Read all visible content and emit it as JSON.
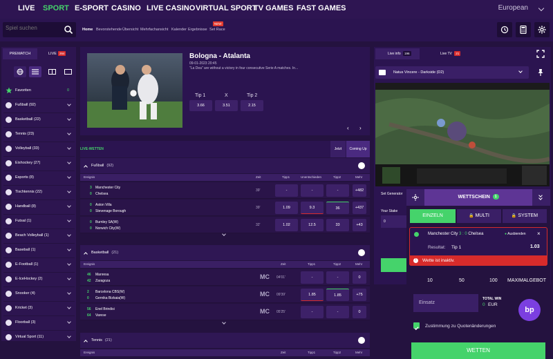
{
  "nav": {
    "items": [
      "LIVE",
      "SPORT",
      "E-SPORT",
      "CASINO",
      "LIVE CASINO",
      "VIRTUAL SPORT",
      "TV GAMES",
      "FAST GAMES"
    ],
    "language": "European"
  },
  "search": {
    "placeholder": "Spiel suchen"
  },
  "sublinks": [
    "Home",
    "Bevorstehende",
    "Übersicht",
    "Mehrfachansicht",
    "Kalender",
    "Ergebnisse",
    "Set Race"
  ],
  "new_badge": "NEW",
  "left": {
    "tab_prematch": "PREMATCH",
    "tab_live": "LIVE",
    "live_count": "264",
    "favorites_label": "Favoriten",
    "favorites_count": "0",
    "sports": [
      "Fußball (92)",
      "Basketball (22)",
      "Tennis (23)",
      "Volleyball (33)",
      "Eishockey (27)",
      "Esports (8)",
      "Tischtennis (22)",
      "Handball (8)",
      "Futsal (1)",
      "Beach Volleyball (1)",
      "Baseball (1)",
      "E-Football (1)",
      "E-IceHockey (2)",
      "Snooker (4)",
      "Kricket (3)",
      "Floorball (3)",
      "Virtual Sport (11)"
    ]
  },
  "featured": {
    "title": "Bologna - Atalanta",
    "datetime": "09-01-2023 20:45",
    "description": "\"La Dea\" are without a victory in four consecutive Serie A matches. In...",
    "odds": [
      {
        "label": "Tip 1",
        "value": "3.66"
      },
      {
        "label": "X",
        "value": "3.51"
      },
      {
        "label": "Tip 2",
        "value": "2.15"
      }
    ]
  },
  "livewetten": {
    "label": "LIVE-WETTEN",
    "jetzt": "Jetzt",
    "coming": "Coming Up"
  },
  "fussball": {
    "title": "Fußball",
    "count": "(92)",
    "headers": {
      "event": "Ereignis",
      "time": "Zeit",
      "tip1": "Tipp1",
      "draw": "Unentschieden",
      "tip2": "Tipp2",
      "more": "Mehr"
    },
    "rows": [
      {
        "s1": "3",
        "t1": "Manchester City",
        "s2": "0",
        "t2": "Chelsea",
        "time": "39'",
        "o1": "-",
        "o2": "-",
        "o3": "-",
        "more": "+482"
      },
      {
        "s1": "0",
        "t1": "Aston Villa",
        "s2": "0",
        "t2": "Stevenage Borough",
        "time": "39'",
        "o1": "1.09",
        "o2": "9.3",
        "o3": "36",
        "more": "+437"
      },
      {
        "s1": "0",
        "t1": "Burnley SA(W)",
        "s2": "0",
        "t2": "Norwich City(W)",
        "time": "32'",
        "o1": "1.02",
        "o2": "12.5",
        "o3": "33",
        "more": "+43"
      }
    ]
  },
  "basketball": {
    "title": "Basketball",
    "count": "(21)",
    "headers": {
      "event": "Ereignis",
      "time": "Zeit",
      "tip1": "Tipp1",
      "tip2": "Tipp2",
      "more": "Mehr"
    },
    "rows": [
      {
        "s1": "46",
        "t1": "Manresa",
        "s2": "42",
        "t2": "Zaragoza",
        "time": "04'01'",
        "o1": "-",
        "o3": "-",
        "more": "0"
      },
      {
        "s1": "2",
        "t1": "Barcelona CBS(W)",
        "s2": "0",
        "t2": "Gernika Bizkaia(W)",
        "time": "09'39'",
        "o1": "1.85",
        "o3": "1.85",
        "more": "+75"
      },
      {
        "s1": "56",
        "t1": "Enel Brindisi",
        "s2": "64",
        "t2": "Varese",
        "time": "05'25'",
        "o1": "-",
        "o3": "-",
        "more": "0"
      }
    ],
    "mc": "MC"
  },
  "tennis": {
    "title": "Tennis",
    "count": "(21)",
    "headers": {
      "event": "Ereignis",
      "time": "Zeit",
      "tip1": "Tipp1",
      "tip2": "Tipp2",
      "more": "Mehr"
    }
  },
  "right": {
    "tab_info": "Live info",
    "info_count": "196",
    "tab_tv": "Live TV",
    "tv_count": "21",
    "stream": "Natus Vincere - Darkside (D2)",
    "set_generator": "Set Generator",
    "your_stake": "Your Stake",
    "stake_value": "0"
  },
  "betslip": {
    "title": "WETTSCHEIN",
    "count": "1",
    "tabs": [
      "EINZELN",
      "MULTI",
      "SYSTEM"
    ],
    "match": "Manchester City",
    "score": "3 : 0",
    "opponent": "Chelsea",
    "status": "Ausbienden",
    "result_label": "Resultat:",
    "result_value": "Tip 1",
    "odd": "1.03",
    "error": "Wette ist inaktiv.",
    "quick": [
      "10",
      "50",
      "100",
      "MAXIMALGEBOT"
    ],
    "stake_placeholder": "Einsatz",
    "total_label": "TOTAL WIN",
    "total_value": "0",
    "currency": "EUR",
    "accept": "Zustimmung zu Quotenänderungen",
    "submit": "WETTEN"
  },
  "colors": {
    "accent": "#45d36b",
    "bg": "#24123f",
    "panel": "#2b1450",
    "red": "#d72b2b"
  }
}
